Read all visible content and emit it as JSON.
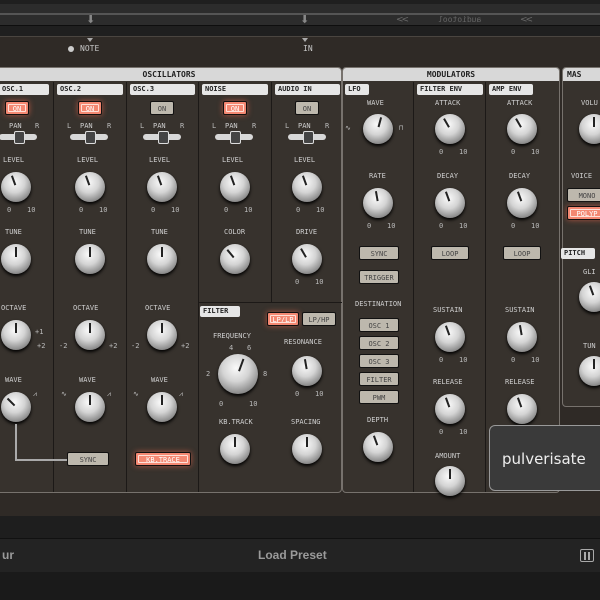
{
  "topbar": {
    "logo_text": "audiotool"
  },
  "sockets": {
    "note": "NOTE",
    "in": "IN"
  },
  "oscillators": {
    "title": "OSCILLATORS",
    "columns": [
      {
        "label": "OSC.1",
        "on": "ON",
        "pan": "PAN",
        "level": "LEVEL",
        "knob2": "TUNE",
        "knob3": "OCTAVE",
        "knob4": "WAVE",
        "button": "SYNC"
      },
      {
        "label": "OSC.2",
        "on": "ON",
        "pan": "PAN",
        "level": "LEVEL",
        "knob2": "TUNE",
        "knob3": "OCTAVE",
        "knob4": "WAVE"
      },
      {
        "label": "OSC.3",
        "on": "ON",
        "pan": "PAN",
        "level": "LEVEL",
        "knob2": "TUNE",
        "knob3": "OCTAVE",
        "knob4": "WAVE",
        "button": "KB.TRACE"
      },
      {
        "label": "NOISE",
        "on": "ON",
        "pan": "PAN",
        "level": "LEVEL",
        "knob2": "COLOR"
      },
      {
        "label": "AUDIO IN",
        "on": "ON",
        "pan": "PAN",
        "level": "LEVEL",
        "knob2": "DRIVE"
      }
    ],
    "ticks": {
      "left": "L",
      "right": "R",
      "min": "0",
      "max": "10",
      "minus2": "-2",
      "plus2": "+2",
      "minus1": "-1",
      "plus1": "+1",
      "zero": "0",
      "two": "2",
      "eight": "8",
      "four": "4",
      "six": "6"
    }
  },
  "filter": {
    "title": "FILTER",
    "mode_lp_lp": "LP/LP",
    "mode_lp_hp": "LP/HP",
    "frequency": "FREQUENCY",
    "resonance": "RESONANCE",
    "kb_track": "KB.TRACK",
    "spacing": "SPACING"
  },
  "modulators": {
    "title": "MODULATORS",
    "lfo": {
      "label": "LFO",
      "wave": "WAVE",
      "rate": "RATE",
      "sync": "SYNC",
      "trigger": "TRIGGER",
      "destination": "DESTINATION",
      "destinations": [
        "OSC 1",
        "OSC 2",
        "OSC 3",
        "FILTER",
        "PWM"
      ],
      "depth": "DEPTH"
    },
    "filter_env": {
      "label": "FILTER ENV",
      "attack": "ATTACK",
      "decay": "DECAY",
      "loop": "LOOP",
      "sustain": "SUSTAIN",
      "release": "RELEASE",
      "amount": "AMOUNT"
    },
    "amp_env": {
      "label": "AMP ENV",
      "attack": "ATTACK",
      "decay": "DECAY",
      "loop": "LOOP",
      "sustain": "SUSTAIN",
      "release": "RELEASE"
    }
  },
  "master": {
    "title": "MAS",
    "volume": "VOLU",
    "voice": "VOICE",
    "mono": "MONO",
    "poly": "POLYP",
    "pitch": "PITCH",
    "glide": "GLI",
    "tune": "TUN"
  },
  "brand": {
    "name": "pulverisate"
  },
  "bottombar": {
    "left_text": "ur",
    "load_preset": "Load Preset"
  }
}
